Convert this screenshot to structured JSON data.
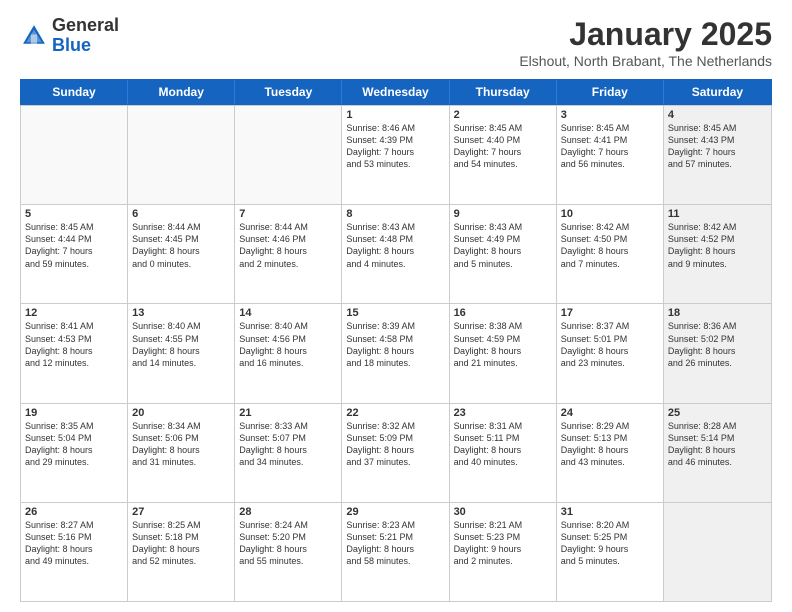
{
  "header": {
    "logo_general": "General",
    "logo_blue": "Blue",
    "month_title": "January 2025",
    "subtitle": "Elshout, North Brabant, The Netherlands"
  },
  "weekdays": [
    "Sunday",
    "Monday",
    "Tuesday",
    "Wednesday",
    "Thursday",
    "Friday",
    "Saturday"
  ],
  "rows": [
    [
      {
        "day": "",
        "text": "",
        "empty": true
      },
      {
        "day": "",
        "text": "",
        "empty": true
      },
      {
        "day": "",
        "text": "",
        "empty": true
      },
      {
        "day": "1",
        "text": "Sunrise: 8:46 AM\nSunset: 4:39 PM\nDaylight: 7 hours\nand 53 minutes."
      },
      {
        "day": "2",
        "text": "Sunrise: 8:45 AM\nSunset: 4:40 PM\nDaylight: 7 hours\nand 54 minutes."
      },
      {
        "day": "3",
        "text": "Sunrise: 8:45 AM\nSunset: 4:41 PM\nDaylight: 7 hours\nand 56 minutes."
      },
      {
        "day": "4",
        "text": "Sunrise: 8:45 AM\nSunset: 4:43 PM\nDaylight: 7 hours\nand 57 minutes.",
        "shaded": true
      }
    ],
    [
      {
        "day": "5",
        "text": "Sunrise: 8:45 AM\nSunset: 4:44 PM\nDaylight: 7 hours\nand 59 minutes."
      },
      {
        "day": "6",
        "text": "Sunrise: 8:44 AM\nSunset: 4:45 PM\nDaylight: 8 hours\nand 0 minutes."
      },
      {
        "day": "7",
        "text": "Sunrise: 8:44 AM\nSunset: 4:46 PM\nDaylight: 8 hours\nand 2 minutes."
      },
      {
        "day": "8",
        "text": "Sunrise: 8:43 AM\nSunset: 4:48 PM\nDaylight: 8 hours\nand 4 minutes."
      },
      {
        "day": "9",
        "text": "Sunrise: 8:43 AM\nSunset: 4:49 PM\nDaylight: 8 hours\nand 5 minutes."
      },
      {
        "day": "10",
        "text": "Sunrise: 8:42 AM\nSunset: 4:50 PM\nDaylight: 8 hours\nand 7 minutes."
      },
      {
        "day": "11",
        "text": "Sunrise: 8:42 AM\nSunset: 4:52 PM\nDaylight: 8 hours\nand 9 minutes.",
        "shaded": true
      }
    ],
    [
      {
        "day": "12",
        "text": "Sunrise: 8:41 AM\nSunset: 4:53 PM\nDaylight: 8 hours\nand 12 minutes."
      },
      {
        "day": "13",
        "text": "Sunrise: 8:40 AM\nSunset: 4:55 PM\nDaylight: 8 hours\nand 14 minutes."
      },
      {
        "day": "14",
        "text": "Sunrise: 8:40 AM\nSunset: 4:56 PM\nDaylight: 8 hours\nand 16 minutes."
      },
      {
        "day": "15",
        "text": "Sunrise: 8:39 AM\nSunset: 4:58 PM\nDaylight: 8 hours\nand 18 minutes."
      },
      {
        "day": "16",
        "text": "Sunrise: 8:38 AM\nSunset: 4:59 PM\nDaylight: 8 hours\nand 21 minutes."
      },
      {
        "day": "17",
        "text": "Sunrise: 8:37 AM\nSunset: 5:01 PM\nDaylight: 8 hours\nand 23 minutes."
      },
      {
        "day": "18",
        "text": "Sunrise: 8:36 AM\nSunset: 5:02 PM\nDaylight: 8 hours\nand 26 minutes.",
        "shaded": true
      }
    ],
    [
      {
        "day": "19",
        "text": "Sunrise: 8:35 AM\nSunset: 5:04 PM\nDaylight: 8 hours\nand 29 minutes."
      },
      {
        "day": "20",
        "text": "Sunrise: 8:34 AM\nSunset: 5:06 PM\nDaylight: 8 hours\nand 31 minutes."
      },
      {
        "day": "21",
        "text": "Sunrise: 8:33 AM\nSunset: 5:07 PM\nDaylight: 8 hours\nand 34 minutes."
      },
      {
        "day": "22",
        "text": "Sunrise: 8:32 AM\nSunset: 5:09 PM\nDaylight: 8 hours\nand 37 minutes."
      },
      {
        "day": "23",
        "text": "Sunrise: 8:31 AM\nSunset: 5:11 PM\nDaylight: 8 hours\nand 40 minutes."
      },
      {
        "day": "24",
        "text": "Sunrise: 8:29 AM\nSunset: 5:13 PM\nDaylight: 8 hours\nand 43 minutes."
      },
      {
        "day": "25",
        "text": "Sunrise: 8:28 AM\nSunset: 5:14 PM\nDaylight: 8 hours\nand 46 minutes.",
        "shaded": true
      }
    ],
    [
      {
        "day": "26",
        "text": "Sunrise: 8:27 AM\nSunset: 5:16 PM\nDaylight: 8 hours\nand 49 minutes."
      },
      {
        "day": "27",
        "text": "Sunrise: 8:25 AM\nSunset: 5:18 PM\nDaylight: 8 hours\nand 52 minutes."
      },
      {
        "day": "28",
        "text": "Sunrise: 8:24 AM\nSunset: 5:20 PM\nDaylight: 8 hours\nand 55 minutes."
      },
      {
        "day": "29",
        "text": "Sunrise: 8:23 AM\nSunset: 5:21 PM\nDaylight: 8 hours\nand 58 minutes."
      },
      {
        "day": "30",
        "text": "Sunrise: 8:21 AM\nSunset: 5:23 PM\nDaylight: 9 hours\nand 2 minutes."
      },
      {
        "day": "31",
        "text": "Sunrise: 8:20 AM\nSunset: 5:25 PM\nDaylight: 9 hours\nand 5 minutes."
      },
      {
        "day": "",
        "text": "",
        "empty": true,
        "shaded": true
      }
    ]
  ]
}
